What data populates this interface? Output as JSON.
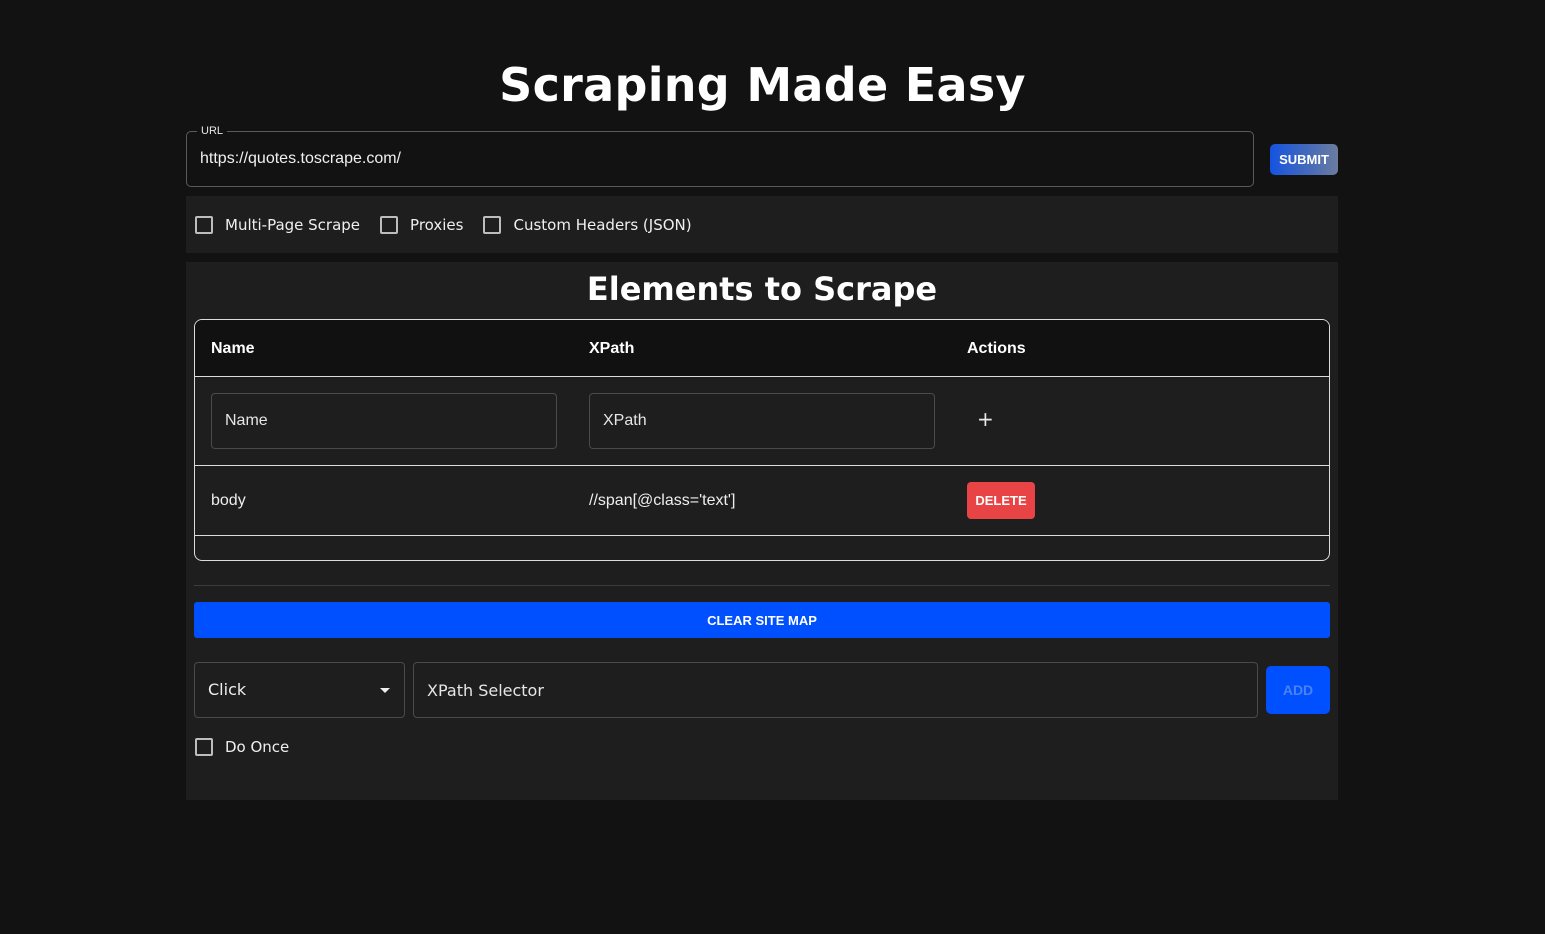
{
  "header": {
    "title": "Scraping Made Easy"
  },
  "url_field": {
    "label": "URL",
    "value": "https://quotes.toscrape.com/"
  },
  "submit_label": "SUBMIT",
  "options": [
    {
      "label": "Multi-Page Scrape",
      "checked": false
    },
    {
      "label": "Proxies",
      "checked": false
    },
    {
      "label": "Custom Headers (JSON)",
      "checked": false
    }
  ],
  "elements_panel": {
    "title": "Elements to Scrape",
    "columns": [
      "Name",
      "XPath",
      "Actions"
    ],
    "new_row": {
      "name_placeholder": "Name",
      "xpath_placeholder": "XPath",
      "add_icon": "+"
    },
    "rows": [
      {
        "name": "body",
        "xpath": "//span[@class='text']",
        "action_label": "DELETE"
      }
    ]
  },
  "clear_site_map_label": "CLEAR SITE MAP",
  "site_map": {
    "action_select_value": "Click",
    "xpath_placeholder": "XPath Selector",
    "add_label": "ADD",
    "do_once_label": "Do Once",
    "do_once_checked": false
  },
  "colors": {
    "background": "#121212",
    "panel": "#1e1e1e",
    "primary": "#0050ff",
    "danger": "#e84445"
  }
}
